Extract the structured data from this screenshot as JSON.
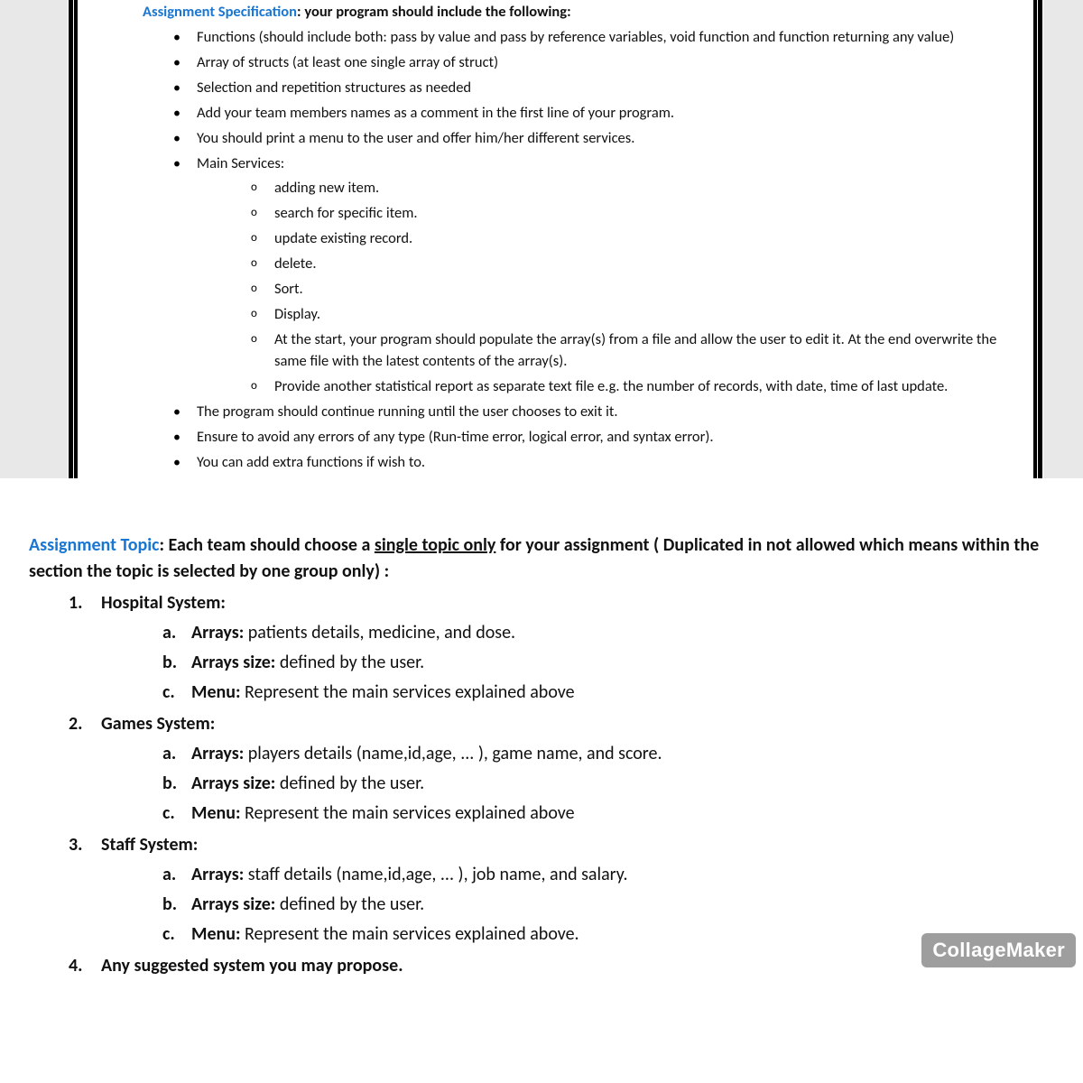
{
  "spec": {
    "title_blue": "Assignment Specification",
    "title_rest": ": your program should include the following:",
    "bullets": [
      "Functions (should include both: pass by value and pass by reference variables, void function and function returning any value)",
      "Array of structs (at least one single array of struct)",
      "Selection and repetition structures as needed",
      "Add your team members names as a comment in the first line of your program.",
      "You should print a menu to the user and offer him/her different services.",
      "Main Services:",
      "The program should continue running until the user chooses to exit it.",
      "Ensure to avoid any errors of any type (Run-time error, logical error, and syntax error).",
      "You can add extra functions if wish to."
    ],
    "services": [
      "adding new item.",
      "search for specific item.",
      "update existing record.",
      "delete.",
      "Sort.",
      " Display.",
      "At the start, your program should populate the array(s) from a file and allow the user to edit it. At the end overwrite the same file with the latest contents of the array(s).",
      " Provide another statistical report as separate text file e.g. the number of records, with date, time of last update."
    ]
  },
  "topic": {
    "title_blue": "Assignment Topic",
    "title_rest_before": ": Each team should choose a ",
    "title_underline": "single topic only",
    "title_rest_after": " for your assignment ( Duplicated in not allowed which means within the section the topic is selected by one group only) :",
    "items": [
      {
        "num": "1.",
        "name": "Hospital System:",
        "sub": [
          {
            "letter": "a.",
            "label": "Arrays:",
            "text": " patients details, medicine, and dose."
          },
          {
            "letter": "b.",
            "label": "Arrays size:",
            "text": " defined by the user."
          },
          {
            "letter": "c.",
            "label": "Menu:",
            "text": " Represent the main services explained above"
          }
        ]
      },
      {
        "num": "2.",
        "name": "Games System:",
        "sub": [
          {
            "letter": "a.",
            "label": "Arrays:",
            "text": " players details (name,id,age, ... ), game name, and score."
          },
          {
            "letter": "b.",
            "label": "Arrays size:",
            "text": " defined by the user."
          },
          {
            "letter": "c.",
            "label": "Menu:",
            "text": " Represent the main services explained above"
          }
        ]
      },
      {
        "num": "3.",
        "name": "Staff System:",
        "sub": [
          {
            "letter": "a.",
            "label": "Arrays:",
            "text": " staff details (name,id,age, ... ), job name, and salary."
          },
          {
            "letter": "b.",
            "label": "Arrays size:",
            "text": " defined by the user."
          },
          {
            "letter": "c.",
            "label": "Menu:",
            "text": " Represent the main services explained above."
          }
        ]
      },
      {
        "num": "4.",
        "name": "Any suggested system you may propose.",
        "sub": []
      }
    ]
  },
  "watermark": "CollageMaker"
}
